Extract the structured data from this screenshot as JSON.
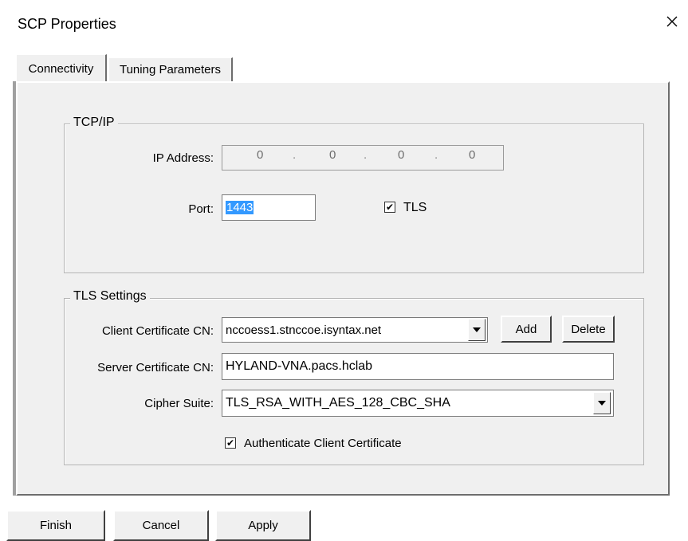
{
  "window": {
    "title": "SCP Properties",
    "close_icon": "close-icon"
  },
  "tabs": [
    {
      "label": "Connectivity",
      "active": true
    },
    {
      "label": "Tuning Parameters",
      "active": false
    }
  ],
  "tcpip": {
    "legend": "TCP/IP",
    "ip_label": "IP Address:",
    "ip_octets": [
      "0",
      "0",
      "0",
      "0"
    ],
    "port_label": "Port:",
    "port_value": "1443",
    "tls_label": "TLS",
    "tls_checked": true
  },
  "tls_settings": {
    "legend": "TLS Settings",
    "client_cert_label": "Client Certificate CN:",
    "client_cert_value": "nccoess1.stnccoe.isyntax.net",
    "add_label": "Add",
    "delete_label": "Delete",
    "server_cert_label": "Server Certificate CN:",
    "server_cert_value": "HYLAND-VNA.pacs.hclab",
    "cipher_label": "Cipher Suite:",
    "cipher_value": "TLS_RSA_WITH_AES_128_CBC_SHA",
    "auth_label": "Authenticate Client Certificate",
    "auth_checked": true
  },
  "footer": {
    "finish_label": "Finish",
    "cancel_label": "Cancel",
    "apply_label": "Apply"
  },
  "glyphs": {
    "check": "✔",
    "close": "✕"
  }
}
